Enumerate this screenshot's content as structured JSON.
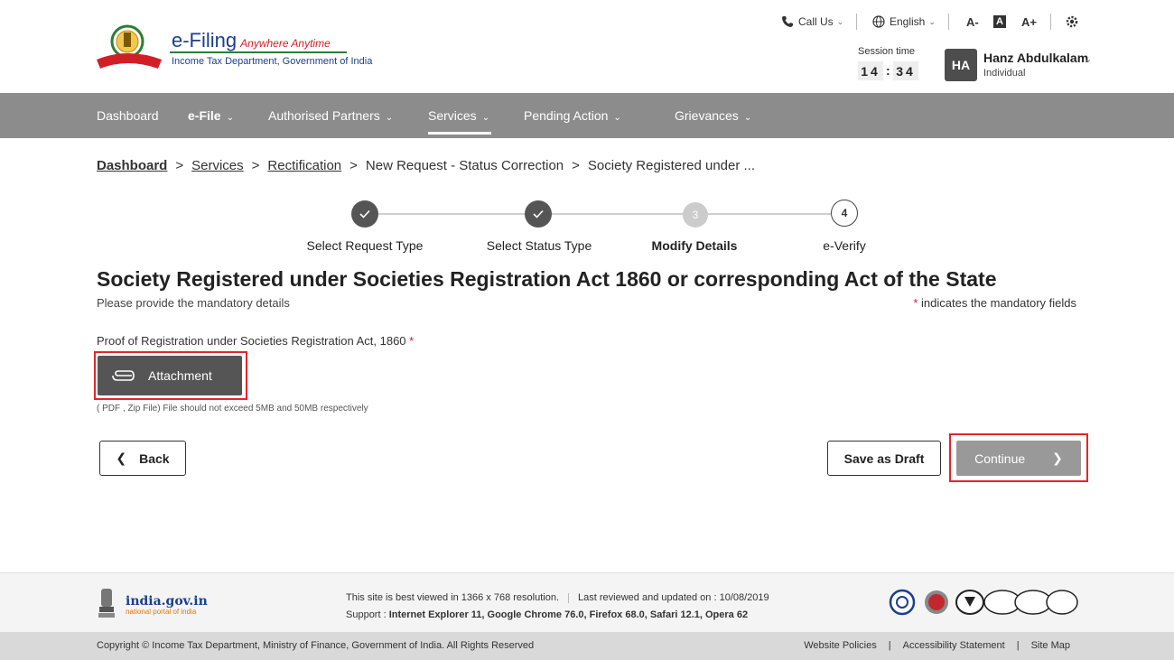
{
  "header": {
    "logo_title": "e-Filing",
    "logo_tagline": "Anywhere Anytime",
    "logo_subtitle": "Income Tax Department, Government of India",
    "call_us": "Call Us",
    "language": "English",
    "font_decrease": "A-",
    "font_normal": "A",
    "font_increase": "A+",
    "session_label": "Session time",
    "session_minutes": "14",
    "session_seconds": "34",
    "user_initials": "HA",
    "user_name": "Hanz Abdulkalam",
    "user_role": "Individual"
  },
  "nav": {
    "items": [
      {
        "label": "Dashboard",
        "has_caret": false
      },
      {
        "label": "e-File",
        "has_caret": true
      },
      {
        "label": "Authorised Partners",
        "has_caret": true
      },
      {
        "label": "Services",
        "has_caret": true,
        "active": true
      },
      {
        "label": "Pending Action",
        "has_caret": true
      },
      {
        "label": "Grievances",
        "has_caret": true
      }
    ]
  },
  "breadcrumb": {
    "items": [
      "Dashboard",
      "Services",
      "Rectification"
    ],
    "current_parent": "New Request - Status Correction",
    "current": "Society Registered under ..."
  },
  "stepper": {
    "steps": [
      {
        "label": "Select Request Type",
        "state": "done",
        "num": ""
      },
      {
        "label": "Select Status Type",
        "state": "done",
        "num": ""
      },
      {
        "label": "Modify Details",
        "state": "current",
        "num": "3"
      },
      {
        "label": "e-Verify",
        "state": "todo",
        "num": "4"
      }
    ]
  },
  "main": {
    "title": "Society Registered under Societies Registration Act 1860 or corresponding Act of the State",
    "subtitle": "Please provide the mandatory details",
    "mandatory_note": "indicates the mandatory fields",
    "mandatory_marker": "*",
    "field_label": "Proof of Registration under Societies Registration Act, 1860",
    "attachment_label": "Attachment",
    "attachment_hint": "( PDF , Zip File) File should not exceed 5MB and 50MB respectively",
    "back_label": "Back",
    "save_draft_label": "Save as Draft",
    "continue_label": "Continue"
  },
  "footer": {
    "gov_title": "india.gov.in",
    "gov_sub": "national portal of india",
    "resolution_note": "This site is best viewed in 1366 x 768 resolution.",
    "last_reviewed": "Last reviewed and updated on : 10/08/2019",
    "support_prefix": "Support :",
    "support_browsers": "Internet Explorer 11, Google Chrome 76.0,  Firefox 68.0, Safari 12.1, Opera 62",
    "copyright": "Copyright © Income Tax Department, Ministry of Finance, Government of India. All Rights Reserved",
    "links": [
      "Website Policies",
      "Accessibility Statement",
      "Site Map"
    ]
  },
  "colors": {
    "nav_bg": "#8c8c8c",
    "highlight": "#e5242b",
    "brand_blue": "#1d3f8b",
    "continue_disabled": "#999999"
  }
}
